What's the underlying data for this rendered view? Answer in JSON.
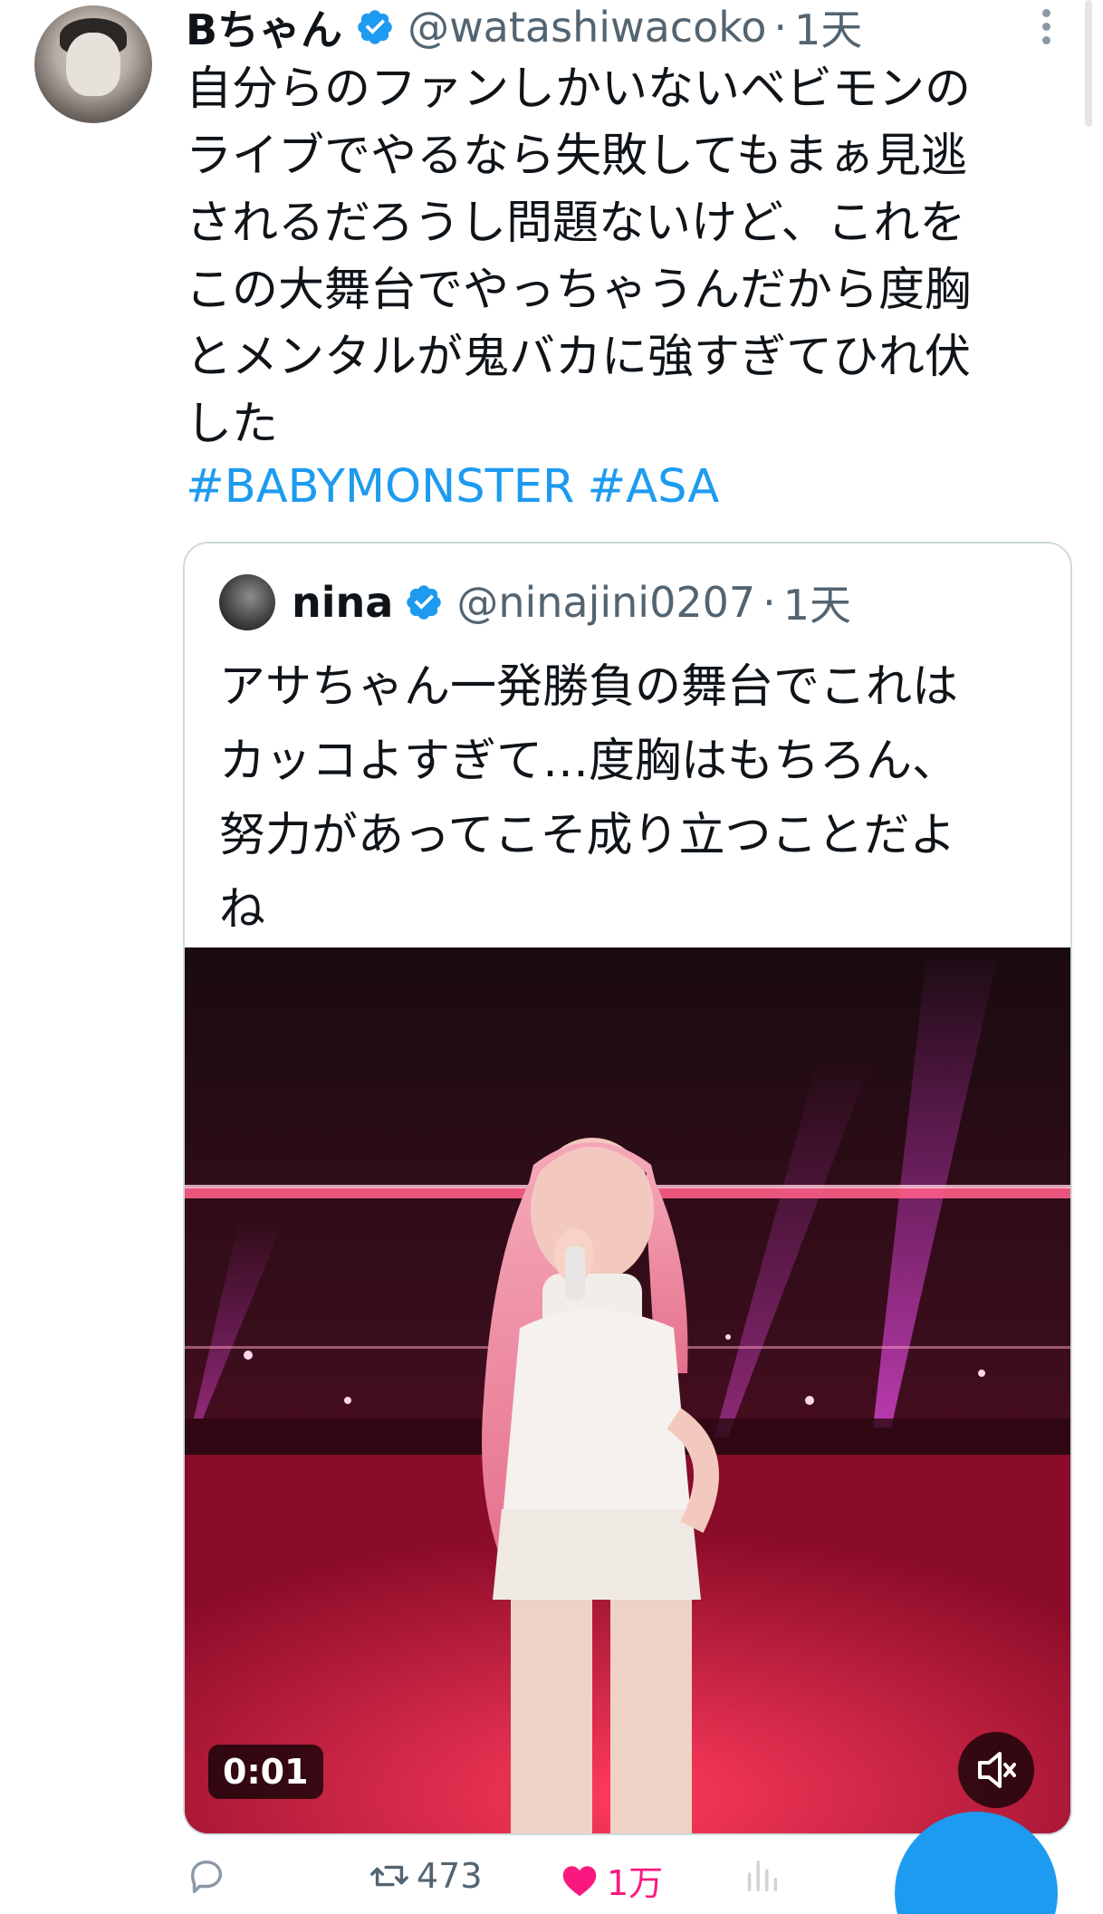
{
  "tweet": {
    "display_name": "Bちゃん",
    "handle": "@watashiwacoko",
    "separator": "·",
    "time": "1天",
    "text": "自分らのファンしかいないベビモンの\nライブでやるなら失敗してもまぁ見逃\nされるだろうし問題ないけど、これを\nこの大舞台でやっちゃうんだから度胸\nとメンタルが鬼バカに強すぎてひれ伏\nした",
    "hashtags": [
      "#BABYMONSTER",
      "#ASA"
    ]
  },
  "quoted_tweet": {
    "display_name": "nina",
    "handle": "@ninajini0207",
    "separator": "·",
    "time": "1天",
    "text": "アサちゃん一発勝負の舞台でこれは\nカッコよすぎて…度胸はもちろん、\n努力があってこそ成り立つことだよ\nね",
    "video": {
      "timestamp": "0:01",
      "muted": true
    }
  },
  "actions": {
    "reply_count": "",
    "retweet_count": "473",
    "like_count": "1万",
    "liked": true
  },
  "colors": {
    "accent": "#1d9bf0",
    "like": "#f91880",
    "muted_text": "#536471",
    "border": "#cfd9de"
  },
  "icons": {
    "verified": "verified-badge-icon",
    "more": "more-vertical-icon",
    "reply": "reply-icon",
    "retweet": "retweet-icon",
    "like": "heart-icon",
    "views": "views-icon",
    "mute": "speaker-muted-icon"
  }
}
